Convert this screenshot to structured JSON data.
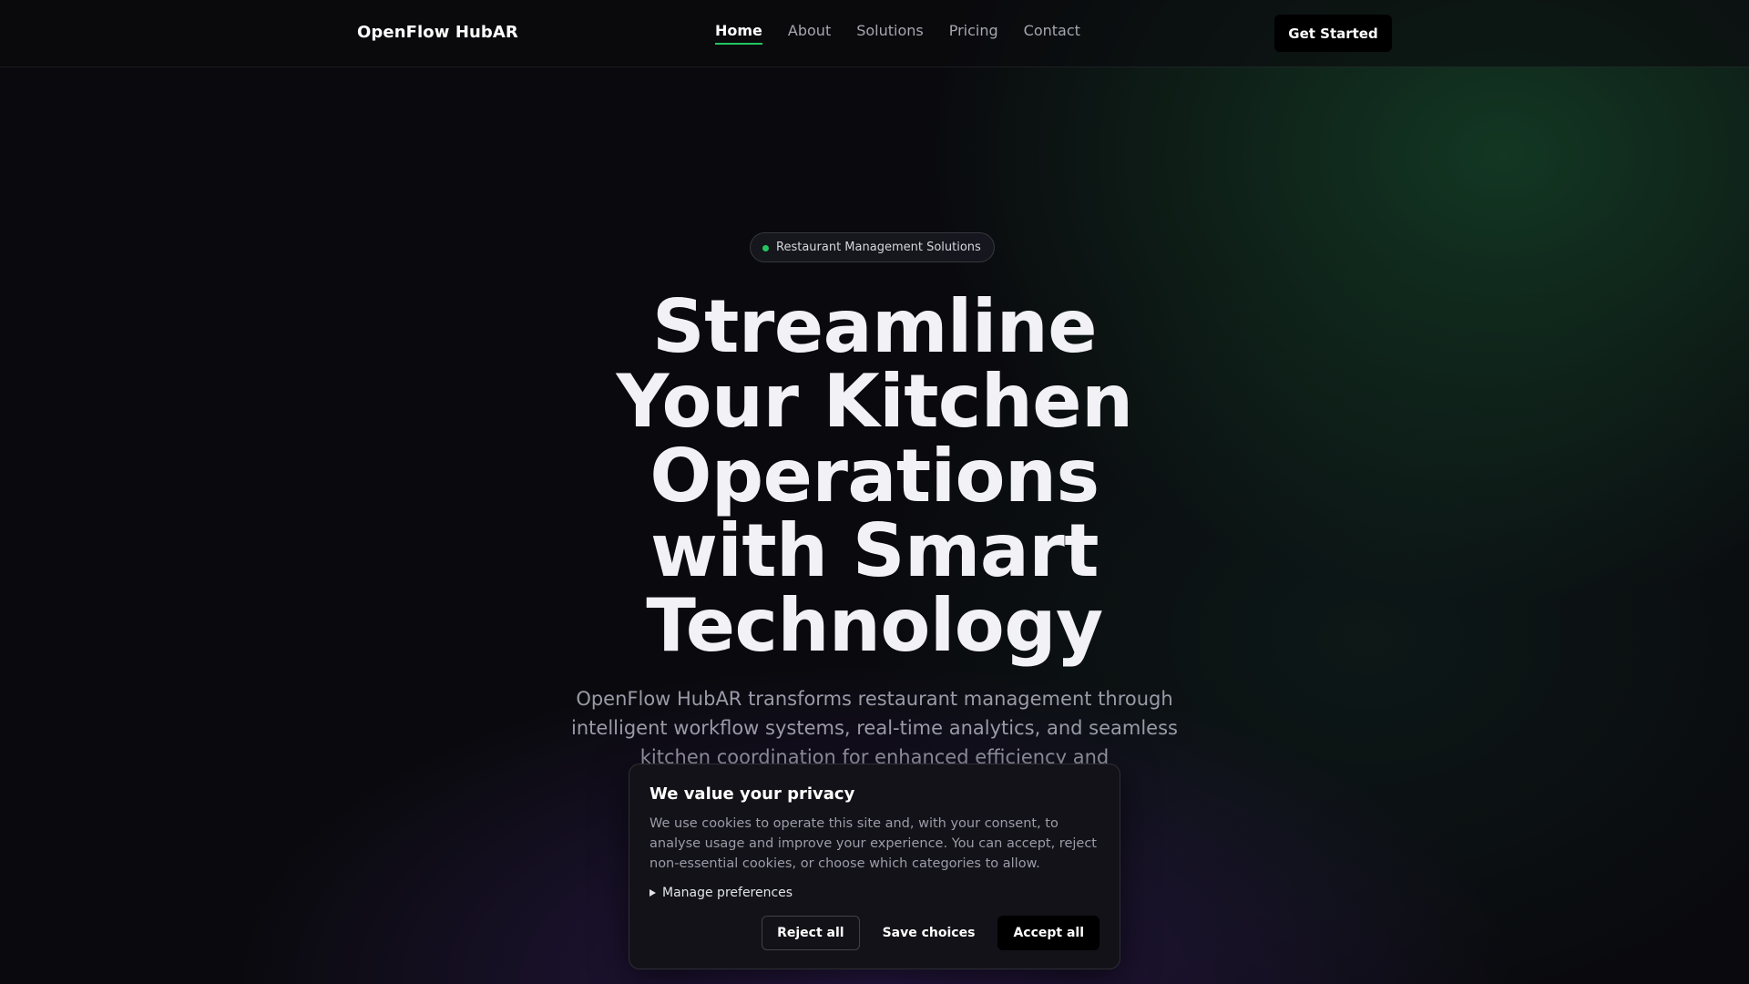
{
  "header": {
    "brand": "OpenFlow HubAR",
    "nav": [
      {
        "label": "Home",
        "active": true
      },
      {
        "label": "About",
        "active": false
      },
      {
        "label": "Solutions",
        "active": false
      },
      {
        "label": "Pricing",
        "active": false
      },
      {
        "label": "Contact",
        "active": false
      }
    ],
    "cta_label": "Get Started"
  },
  "hero": {
    "badge": "Restaurant Management Solutions",
    "title_lines": [
      "Streamline",
      "Your Kitchen",
      "Operations",
      "with Smart",
      "Technology"
    ],
    "subtitle": "OpenFlow HubAR transforms restaurant management through intelligent workflow systems, real-time analytics, and seamless kitchen coordination for enhanced efficiency and"
  },
  "cookie_dialog": {
    "title": "We value your privacy",
    "text": "We use cookies to operate this site and, with your consent, to analyse usage and improve your experience. You can accept, reject non-essential cookies, or choose which categories to allow.",
    "manage_label": "Manage preferences",
    "reject_label": "Reject all",
    "save_label": "Save choices",
    "accept_label": "Accept all"
  },
  "colors": {
    "accent": "#22c55e",
    "background": "#0a0a0e",
    "dialog_bg": "#121218"
  }
}
